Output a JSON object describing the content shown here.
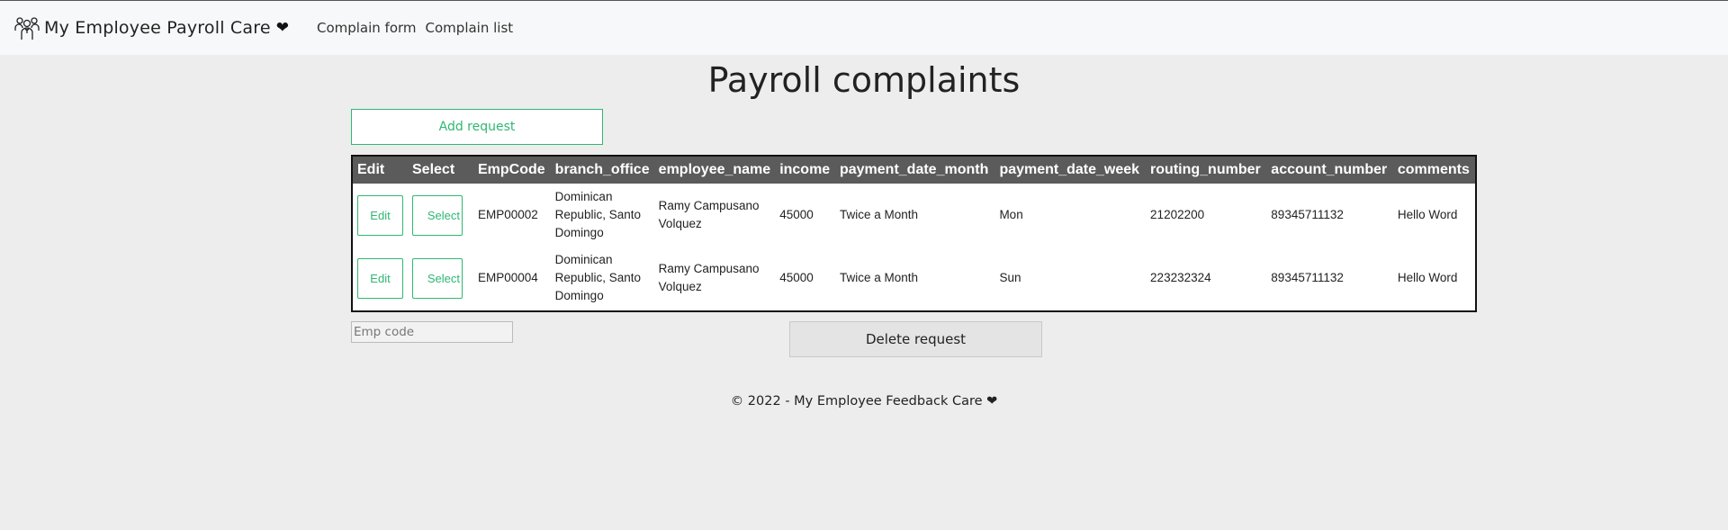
{
  "navbar": {
    "brand": "My Employee Payroll Care",
    "brand_heart": "❤",
    "links": [
      "Complain form",
      "Complain list"
    ]
  },
  "main": {
    "title": "Payroll complaints",
    "add_button": "Add request",
    "table": {
      "headers": [
        "Edit",
        "Select",
        "EmpCode",
        "branch_office",
        "employee_name",
        "income",
        "payment_date_month",
        "payment_date_week",
        "routing_number",
        "account_number",
        "comments"
      ],
      "rows": [
        {
          "edit": "Edit",
          "select": "Select",
          "cells": [
            "EMP00002",
            "Dominican Republic, Santo Domingo",
            "Ramy Campusano Volquez",
            "45000",
            "Twice a Month",
            "Mon",
            "21202200",
            "89345711132",
            "Hello Word"
          ]
        },
        {
          "edit": "Edit",
          "select": "Select",
          "cells": [
            "EMP00004",
            "Dominican Republic, Santo Domingo",
            "Ramy Campusano Volquez",
            "45000",
            "Twice a Month",
            "Sun",
            "223232324",
            "89345711132",
            "Hello Word"
          ]
        }
      ]
    },
    "emp_code_placeholder": "Emp code",
    "delete_button": "Delete request"
  },
  "footer": {
    "text": "© 2022 - My Employee Feedback Care",
    "heart": "❤"
  },
  "colors": {
    "accent": "#2eb872",
    "header_bg": "#5b5b5b",
    "page_bg": "#ededed"
  },
  "icons": {
    "brand_logo": "team-people-icon"
  }
}
